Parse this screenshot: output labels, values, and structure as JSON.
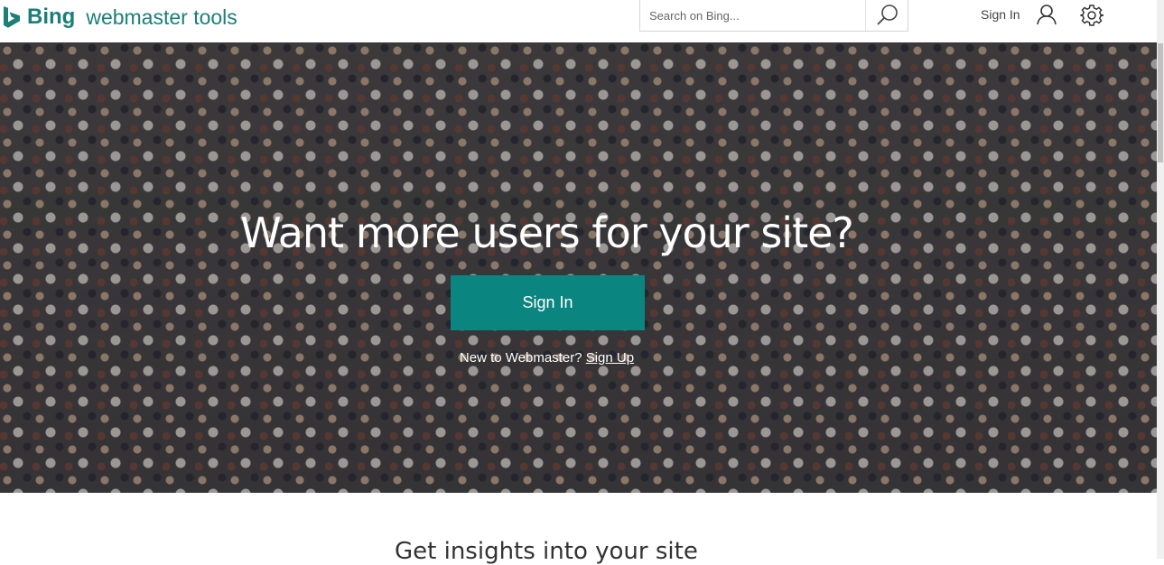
{
  "header": {
    "brand": "Bing",
    "product": "webmaster tools",
    "search_placeholder": "Search on Bing...",
    "signin_label": "Sign In",
    "icons": {
      "search": "search-icon",
      "user": "user-icon",
      "settings": "gear-icon"
    }
  },
  "hero": {
    "title": "Want more users for your site?",
    "signin_button": "Sign In",
    "new_user_text": "New to Webmaster?",
    "signup_link": "Sign Up"
  },
  "section": {
    "title": "Get insights into your site"
  },
  "colors": {
    "brand": "#1b7f78",
    "button": "#0b8580",
    "text": "#333333"
  }
}
